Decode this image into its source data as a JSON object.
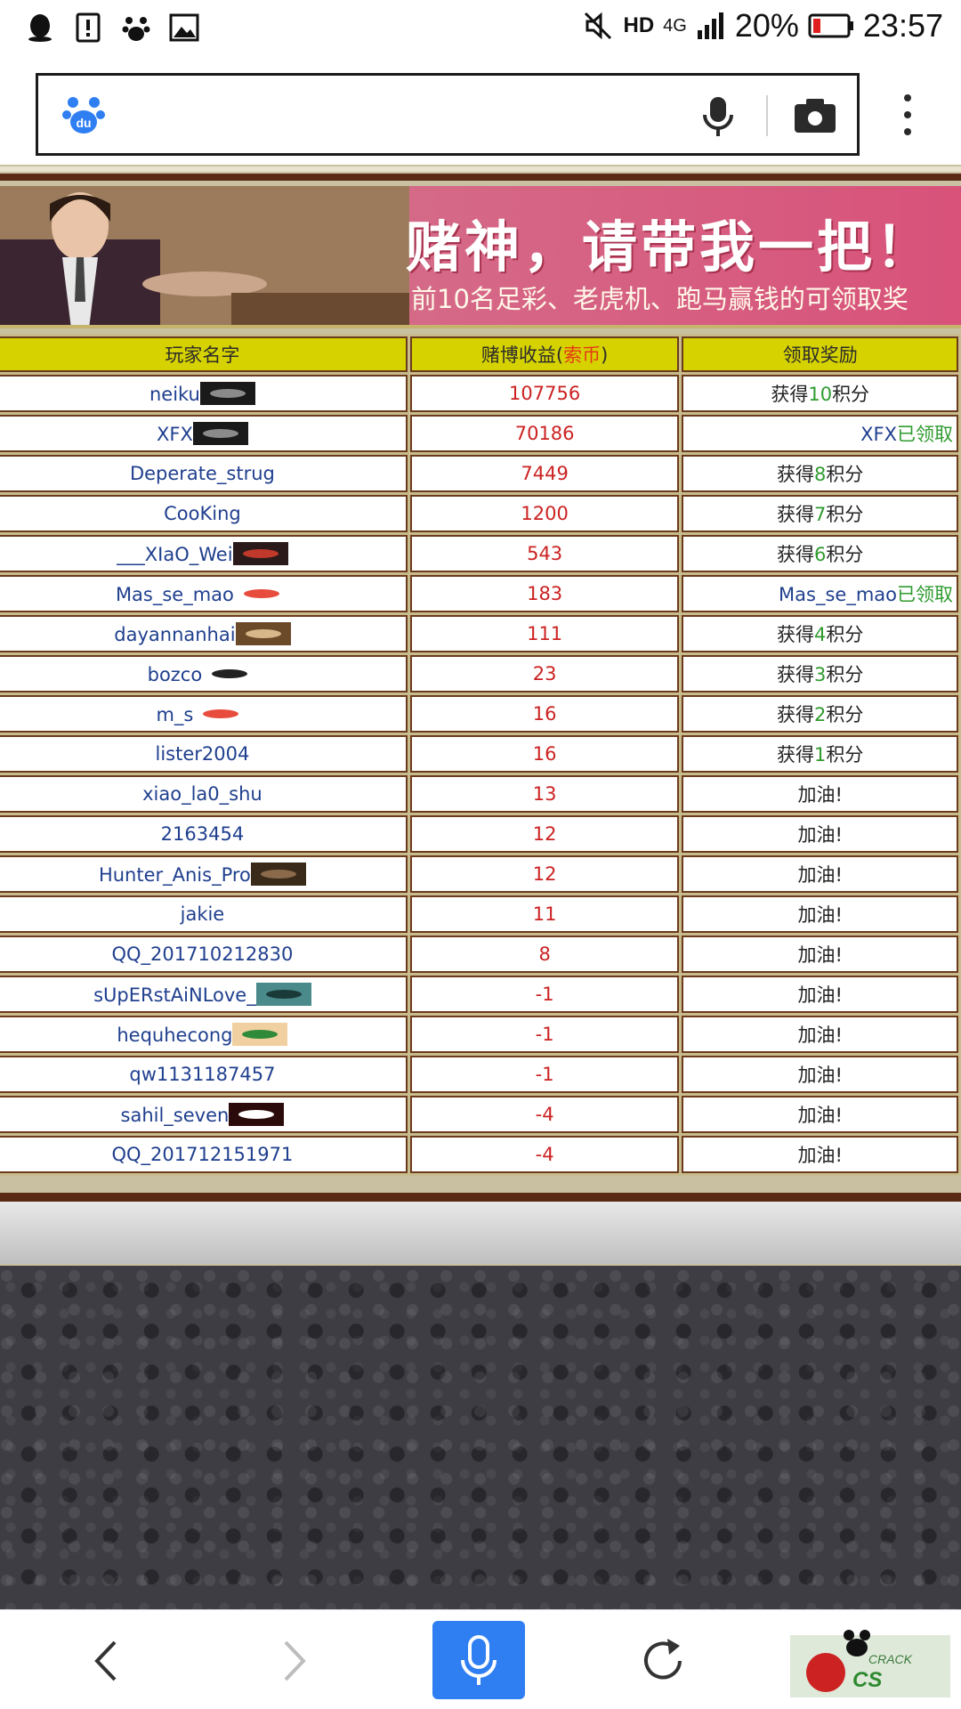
{
  "status_bar": {
    "battery": "20%",
    "time": "23:57",
    "network": "4G",
    "hd": "HD",
    "icons_left": [
      "qq-icon",
      "alert-icon",
      "baidu-paw-icon",
      "gallery-icon"
    ]
  },
  "search": {
    "placeholder": "",
    "value": ""
  },
  "banner": {
    "title": "赌神，请带我一把！",
    "subtitle": "前10名足彩、老虎机、跑马赢钱的可领取奖"
  },
  "table": {
    "headers": {
      "name": "玩家名字",
      "profit_prefix": "赌博收益(",
      "profit_unit": "索币",
      "profit_suffix": ")",
      "reward": "领取奖励"
    },
    "rows": [
      {
        "name": "neiku",
        "badge": "dark",
        "profit": "107756",
        "reward_pre": "获得",
        "reward_num": "10",
        "reward_post": "积分",
        "claimed": false
      },
      {
        "name": "XFX",
        "badge": "dark",
        "profit": "70186",
        "reward_pre": "XFX",
        "reward_num": "已领取",
        "reward_post": "",
        "claimed": true
      },
      {
        "name": "Deperate_strug",
        "badge": "",
        "profit": "7449",
        "reward_pre": "获得",
        "reward_num": "8",
        "reward_post": "积分",
        "claimed": false
      },
      {
        "name": "CooKing",
        "badge": "",
        "profit": "1200",
        "reward_pre": "获得",
        "reward_num": "7",
        "reward_post": "积分",
        "claimed": false
      },
      {
        "name": "___XIaO_Wei",
        "badge": "my",
        "profit": "543",
        "reward_pre": "获得",
        "reward_num": "6",
        "reward_post": "积分",
        "claimed": false
      },
      {
        "name": "Mas_se_mao",
        "badge": "mas",
        "profit": "183",
        "reward_pre": "Mas_se_mao",
        "reward_num": "已领取",
        "reward_post": "",
        "claimed": true
      },
      {
        "name": "dayannanhai",
        "badge": "brown",
        "profit": "111",
        "reward_pre": "获得",
        "reward_num": "4",
        "reward_post": "积分",
        "claimed": false
      },
      {
        "name": "bozco",
        "badge": "pro",
        "profit": "23",
        "reward_pre": "获得",
        "reward_num": "3",
        "reward_post": "积分",
        "claimed": false
      },
      {
        "name": "m_s",
        "badge": "mas",
        "profit": "16",
        "reward_pre": "获得",
        "reward_num": "2",
        "reward_post": "积分",
        "claimed": false
      },
      {
        "name": "lister2004",
        "badge": "",
        "profit": "16",
        "reward_pre": "获得",
        "reward_num": "1",
        "reward_post": "积分",
        "claimed": false
      },
      {
        "name": "xiao_la0_shu",
        "badge": "",
        "profit": "13",
        "reward_pre": "加油!",
        "reward_num": "",
        "reward_post": "",
        "claimed": false
      },
      {
        "name": "2163454",
        "badge": "",
        "profit": "12",
        "reward_pre": "加油!",
        "reward_num": "",
        "reward_post": "",
        "claimed": false
      },
      {
        "name": "Hunter_Anis_Pro",
        "badge": "sepia",
        "profit": "12",
        "reward_pre": "加油!",
        "reward_num": "",
        "reward_post": "",
        "claimed": false
      },
      {
        "name": "jakie",
        "badge": "",
        "profit": "11",
        "reward_pre": "加油!",
        "reward_num": "",
        "reward_post": "",
        "claimed": false
      },
      {
        "name": "QQ_201710212830",
        "badge": "",
        "profit": "8",
        "reward_pre": "加油!",
        "reward_num": "",
        "reward_post": "",
        "claimed": false
      },
      {
        "name": "sUpERstAiNLove_",
        "badge": "teal",
        "profit": "-1",
        "reward_pre": "加油!",
        "reward_num": "",
        "reward_post": "",
        "claimed": false
      },
      {
        "name": "hequhecong",
        "badge": "leaf",
        "profit": "-1",
        "reward_pre": "加油!",
        "reward_num": "",
        "reward_post": "",
        "claimed": false
      },
      {
        "name": "qw1131187457",
        "badge": "",
        "profit": "-1",
        "reward_pre": "加油!",
        "reward_num": "",
        "reward_post": "",
        "claimed": false
      },
      {
        "name": "sahil_seven",
        "badge": "devil",
        "profit": "-4",
        "reward_pre": "加油!",
        "reward_num": "",
        "reward_post": "",
        "claimed": false
      },
      {
        "name": "QQ_201712151971",
        "badge": "",
        "profit": "-4",
        "reward_pre": "加油!",
        "reward_num": "",
        "reward_post": "",
        "claimed": false
      }
    ]
  },
  "colors": {
    "header_bg": "#d6d200",
    "name_text": "#1f3f8e",
    "profit_text": "#cc2222",
    "claimed_green": "#2f9b2f",
    "brand_blue": "#2f7ff2"
  }
}
